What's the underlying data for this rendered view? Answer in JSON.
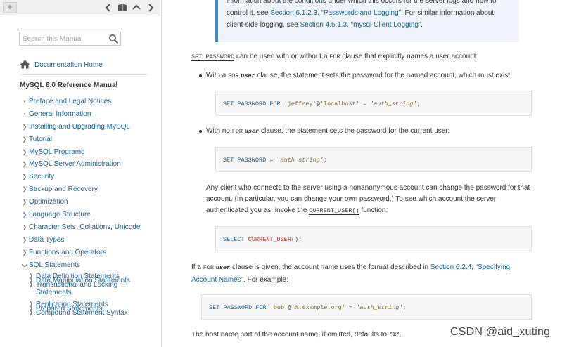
{
  "sidebar": {
    "search_placeholder": "Search this Manual",
    "doc_home": "Documentation Home",
    "manual_title": "MySQL 8.0 Reference Manual",
    "toc": [
      {
        "label": "Preface and Legal Notices",
        "marker": "dot"
      },
      {
        "label": "General Information",
        "marker": "dot"
      },
      {
        "label": "Installing and Upgrading MySQL",
        "marker": "chevron-right"
      },
      {
        "label": "Tutorial",
        "marker": "chevron-right"
      },
      {
        "label": "MySQL Programs",
        "marker": "chevron-right"
      },
      {
        "label": "MySQL Server Administration",
        "marker": "chevron-right"
      },
      {
        "label": "Security",
        "marker": "chevron-right"
      },
      {
        "label": "Backup and Recovery",
        "marker": "chevron-right"
      },
      {
        "label": "Optimization",
        "marker": "chevron-right"
      },
      {
        "label": "Language Structure",
        "marker": "chevron-right"
      },
      {
        "label": "Character Sets, Collations, Unicode",
        "marker": "chevron-right"
      },
      {
        "label": "Data Types",
        "marker": "chevron-right"
      },
      {
        "label": "Functions and Operators",
        "marker": "chevron-right"
      },
      {
        "label": "SQL Statements",
        "marker": "chevron-down"
      }
    ],
    "subtoc": [
      {
        "label": "Data Definition Statements"
      },
      {
        "label": "Data Manipulation Statements"
      },
      {
        "label": "Transactional and Locking",
        "label2": "Statements"
      },
      {
        "label": "Replication Statements"
      },
      {
        "label": "Prepared Statements"
      },
      {
        "label": "Compound Statement Syntax"
      }
    ]
  },
  "note": {
    "l1": "information about the conditions under which this occurs for the server logs and how to",
    "l2a": "control it, see ",
    "l2link": "Section 6.1.2.3, “Passwords and Logging”",
    "l2b": ". For similar information about",
    "l3a": "client-side logging, see ",
    "l3link": "Section 4.5.1.3, “mysql Client Logging”",
    "l3b": "."
  },
  "para1": {
    "code1": "SET PASSWORD",
    "t1": " can be used with or without a ",
    "code2": "FOR",
    "t2": " clause that explicitly names a user account:"
  },
  "bullet1": {
    "t1": "With a ",
    "code1": "FOR",
    "code2": "user",
    "t2": " clause, the statement sets the password for the named account, which must exist:"
  },
  "code_a": {
    "kw": "SET PASSWORD FOR",
    "s1": "'jeffrey'",
    "at": "@",
    "s2": "'localhost'",
    "eq": " = ",
    "v": "'auth_string'",
    "end": ";"
  },
  "bullet2": {
    "t1": "With no ",
    "code1": "FOR",
    "code2": "user",
    "t2": " clause, the statement sets the password for the current user:"
  },
  "code_b": {
    "kw": "SET PASSWORD",
    "eq": " = ",
    "v": "'auth_string'",
    "end": ";"
  },
  "para2": {
    "l1": "Any client who connects to the server using a nonanonymous account can change the password for that",
    "l2": "account. (In particular, you can change your own password.) To see which account the server",
    "l3a": "authenticated you as, invoke the ",
    "l3code": "CURRENT_USER()",
    "l3b": " function:"
  },
  "code_c": {
    "kw": "SELECT",
    "fn": "CURRENT_USER",
    "end": "();"
  },
  "para3": {
    "t1": "If a ",
    "code1": "FOR",
    "code2": "user",
    "t2": " clause is given, the account name uses the format described in ",
    "link1": "Section 6.2.4, “Specifying",
    "link2": "Account Names”",
    "t3": ". For example:"
  },
  "code_d": {
    "kw": "SET PASSWORD FOR",
    "s1": "'bob'",
    "at": "@",
    "s2": "'%.example.org'",
    "eq": " = ",
    "v": "'auth_string'",
    "end": ";"
  },
  "para4": {
    "t1": "The host name part of the account name, if omitted, defaults to ",
    "code1": "'%'",
    "t2": "."
  },
  "watermark": "CSDN @aid_xuting",
  "colors": {
    "link": "#1a6396",
    "note_bar": "#3f8dc6",
    "note_bg": "#eef4fa"
  }
}
